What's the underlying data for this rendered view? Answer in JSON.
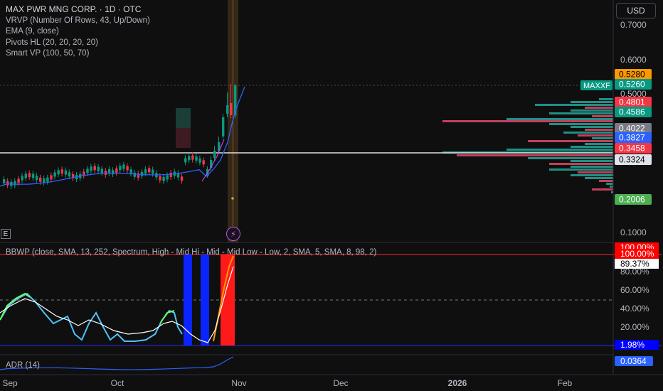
{
  "legend": {
    "title": "MAX PWR MNG CORP. · 1D · OTC",
    "indicators": [
      "VRVP (Number Of Rows, 43, Up/Down)",
      "EMA (9, close)",
      "Pivots HL (20, 20, 20, 20)",
      "Smart VP (100, 50, 70)"
    ]
  },
  "currency": "USD",
  "e_marker": "E",
  "bolt_icon": "lightning-bolt-icon",
  "price_axis": {
    "ticks": [
      "0.7000",
      "0.6000",
      "0.5000",
      "0.1000"
    ]
  },
  "price_badges": [
    {
      "label": "0.5280",
      "bg": "#ff9800",
      "fg": "#000000"
    },
    {
      "label": "0.5260",
      "bg": "#089981",
      "fg": "#ffffff"
    },
    {
      "label": "0.4801",
      "bg": "#f23645",
      "fg": "#ffffff"
    },
    {
      "label": "0.4586",
      "bg": "#089981",
      "fg": "#ffffff"
    },
    {
      "label": "0.4022",
      "bg": "#787b86",
      "fg": "#ffffff"
    },
    {
      "label": "0.3827",
      "bg": "#2962ff",
      "fg": "#ffffff"
    },
    {
      "label": "0.3458",
      "bg": "#f23645",
      "fg": "#ffffff"
    },
    {
      "label": "0.3324",
      "bg": "#e0e3eb",
      "fg": "#000000"
    },
    {
      "label": "0.2006",
      "bg": "#4caf50",
      "fg": "#ffffff"
    }
  ],
  "symbol_tag": "MAXXF",
  "oscillator": {
    "title": "BBWP (close, SMA, 13, 252, Spectrum, High - Mid Hi - Mid - Mid Low - Low, 2, SMA, 5, SMA, 8, 98, 2)",
    "ticks": [
      "80.00%",
      "60.00%",
      "40.00%",
      "20.00%"
    ],
    "badges": [
      {
        "label": "100.00%",
        "bg": "#ff0000",
        "fg": "#ffffff"
      },
      {
        "label": "100.00%",
        "bg": "#ff0000",
        "fg": "#ffffff"
      },
      {
        "label": "89.37%",
        "bg": "#ffffff",
        "fg": "#000000"
      },
      {
        "label": "1.98%",
        "bg": "#0000ff",
        "fg": "#ffffff"
      }
    ]
  },
  "adr": {
    "title": "ADR (14)",
    "badge": {
      "label": "0.0364",
      "bg": "#2962ff",
      "fg": "#ffffff"
    }
  },
  "time_axis": {
    "labels": [
      {
        "text": "Sep",
        "bold": false
      },
      {
        "text": "Oct",
        "bold": false
      },
      {
        "text": "Nov",
        "bold": false
      },
      {
        "text": "Dec",
        "bold": false
      },
      {
        "text": "2026",
        "bold": true
      },
      {
        "text": "Feb",
        "bold": false
      }
    ]
  },
  "colors": {
    "up": "#089981",
    "down": "#f23645",
    "ema": "#2962ff",
    "bg": "#0f0f0f"
  }
}
